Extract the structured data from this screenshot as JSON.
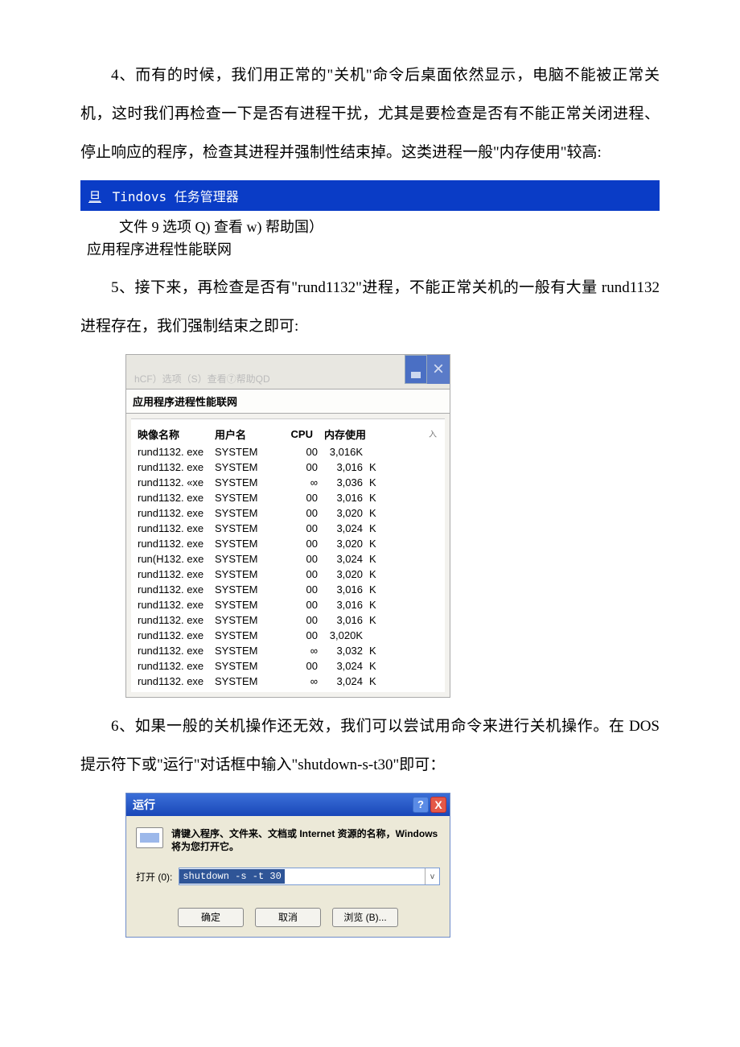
{
  "para4": "4、而有的时候，我们用正常的\"关机\"命令后桌面依然显示，电脑不能被正常关机，这时我们再检查一下是否有进程干扰，尤其是要检查是否有不能正常关闭进程、停止响应的程序，检查其进程并强制性结束掉。这类进程一般\"内存使用\"较高:",
  "tm1": {
    "title_underline": "旦",
    "title": "Tindovs 任务管理器",
    "menubar": "文件 9 选项 Q) 查看 w) 帮助国）",
    "tabs": "应用程序进程性能联网"
  },
  "para5": "5、接下来，再检查是否有\"rund1132\"进程，不能正常关机的一般有大量 rund1132 进程存在，我们强制结束之即可:",
  "tm2": {
    "titlemenu": "hCF）选项（S）查看⑦帮助QD",
    "tabs": "应用程序进程性能联网",
    "head_small": "入",
    "cols": {
      "image": "映像名称",
      "user": "用户名",
      "cpu": "CPU",
      "mem": "内存使用"
    },
    "rows": [
      {
        "image": "rund1132. exe",
        "user": "SYSTEM",
        "cpu": "00",
        "mem": "3,016K",
        "k": ""
      },
      {
        "image": "rund1132. exe",
        "user": "SYSTEM",
        "cpu": "00",
        "mem": "3,016",
        "k": "K"
      },
      {
        "image": "rund1132. «xe",
        "user": "SYSTEM",
        "cpu": "∞",
        "mem": "3,036",
        "k": "K"
      },
      {
        "image": "rund1132. exe",
        "user": "SYSTEM",
        "cpu": "00",
        "mem": "3,016",
        "k": "K"
      },
      {
        "image": "rund1132. exe",
        "user": "SYSTEM",
        "cpu": "00",
        "mem": "3,020",
        "k": "K"
      },
      {
        "image": "rund1132. exe",
        "user": "SYSTEM",
        "cpu": "00",
        "mem": "3,024",
        "k": "K"
      },
      {
        "image": "rund1132. exe",
        "user": "SYSTEM",
        "cpu": "00",
        "mem": "3,020",
        "k": "K"
      },
      {
        "image": "run(H132. exe",
        "user": "SYSTEM",
        "cpu": "00",
        "mem": "3,024",
        "k": "K"
      },
      {
        "image": "rund1132. exe",
        "user": "SYSTEM",
        "cpu": "00",
        "mem": "3,020",
        "k": "K"
      },
      {
        "image": "rund1132. exe",
        "user": "SYSTEM",
        "cpu": "00",
        "mem": "3,016",
        "k": "K"
      },
      {
        "image": "rund1132. exe",
        "user": "SYSTEM",
        "cpu": "00",
        "mem": "3,016",
        "k": "K"
      },
      {
        "image": "rund1132. exe",
        "user": "SYSTEM",
        "cpu": "00",
        "mem": "3,016",
        "k": "K"
      },
      {
        "image": "rund1132. exe",
        "user": "SYSTEM",
        "cpu": "00",
        "mem": "3,020K",
        "k": ""
      },
      {
        "image": "rund1132. exe",
        "user": "SYSTEM",
        "cpu": "∞",
        "mem": "3,032",
        "k": "K"
      },
      {
        "image": "rund1132. exe",
        "user": "SYSTEM",
        "cpu": "00",
        "mem": "3,024",
        "k": "K"
      },
      {
        "image": "rund1132. exe",
        "user": "SYSTEM",
        "cpu": "∞",
        "mem": "3,024",
        "k": "K"
      }
    ]
  },
  "para6": "6、如果一般的关机操作还无效，我们可以尝试用命令来进行关机操作。在 DOS 提示符下或\"运行\"对话框中输入\"shutdown-s-t30\"即可：",
  "run": {
    "title": "运行",
    "help": "?",
    "close": "X",
    "desc": "请键入程序、文件来、文档或 Internet 资源的名称，Windows 将为您打开它。",
    "open_label": "打开 (0):",
    "input": "shutdown -s -t 30",
    "dropdown": "v",
    "ok": "确定",
    "cancel": "取消",
    "browse": "浏览 (B)..."
  }
}
